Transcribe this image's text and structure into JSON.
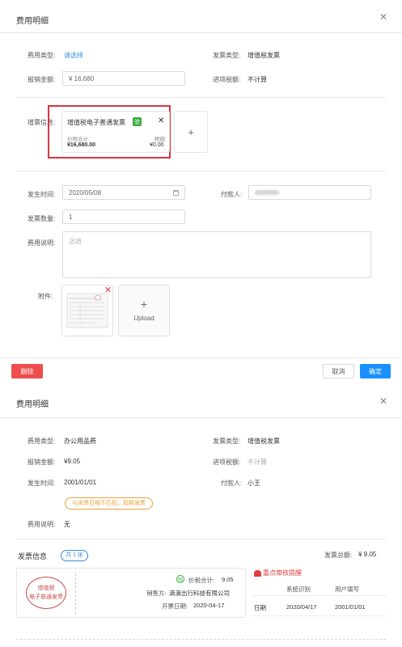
{
  "top": {
    "title": "费用明细",
    "fee_type_label": "费用类型:",
    "fee_type_value": "请选择",
    "invoice_type_label": "发票类型:",
    "invoice_type_value": "增值税发票",
    "amount_label": "报销金额:",
    "amount_value": "¥ 16,680",
    "tax_label": "进项税额:",
    "tax_value": "不计算",
    "vat_label": "增票信息:",
    "card": {
      "title": "增值税电子普通发票",
      "badge": "验",
      "total_label": "价税合计",
      "total_value": "¥16,680.00",
      "tax_label": "税额",
      "tax_value": "¥0.00"
    },
    "add_symbol": "+",
    "date_label": "发生时间:",
    "date_value": "2020/05/08",
    "payer_label": "付款人:",
    "qty_label": "发票数量:",
    "qty_value": "1",
    "desc_label": "费用说明:",
    "desc_placeholder": "选填",
    "attach_label": "附件:",
    "upload_plus": "+",
    "upload_label": "Upload",
    "delete_button": "删除",
    "cancel_button": "取消",
    "ok_button": "确定",
    "colors": {
      "primary": "#1890ff",
      "danger": "#ef4d4d",
      "highlight_border": "#d9363e"
    }
  },
  "bottom": {
    "title": "费用明细",
    "fee_type_label": "费用类型:",
    "fee_type_value": "办公用品费",
    "invoice_type_label": "发票类型:",
    "invoice_type_value": "增值税发票",
    "amount_label": "报销金额:",
    "amount_value": "¥9.05",
    "tax_label": "进项税额:",
    "tax_value": "不计算",
    "date_label": "发生时间:",
    "date_value": "2001/01/01",
    "payer_label": "付款人:",
    "payer_value": "小王",
    "warning": "与发票日期不匹配，超期发票",
    "desc_label": "费用说明:",
    "desc_value": "无",
    "invoice_info_label": "发票信息",
    "invoice_count": "共 1 张",
    "invoice_total_label": "发票总额:",
    "invoice_total_value": "¥ 9.05",
    "stamp_line1": "增值税",
    "stamp_line2": "电子普通发票",
    "badge": "验",
    "ticket_total_label": "价税合计:",
    "ticket_total_value": "9.05",
    "seller_label": "销售方:",
    "seller_value": "滴滴出行科技有限公司",
    "issue_date_label": "开票日期:",
    "issue_date_value": "2020-04-17",
    "review_alert": "重点审核提醒",
    "col_system": "系统识别",
    "col_user": "用户填写",
    "row_label": "日期",
    "row_system": "2020/04/17",
    "row_user": "2001/01/01",
    "colors": {
      "warning": "#e8a33d",
      "alert": "#e03c3c",
      "stamp": "#c94b4b",
      "verify_green": "#3aaa3a"
    }
  }
}
